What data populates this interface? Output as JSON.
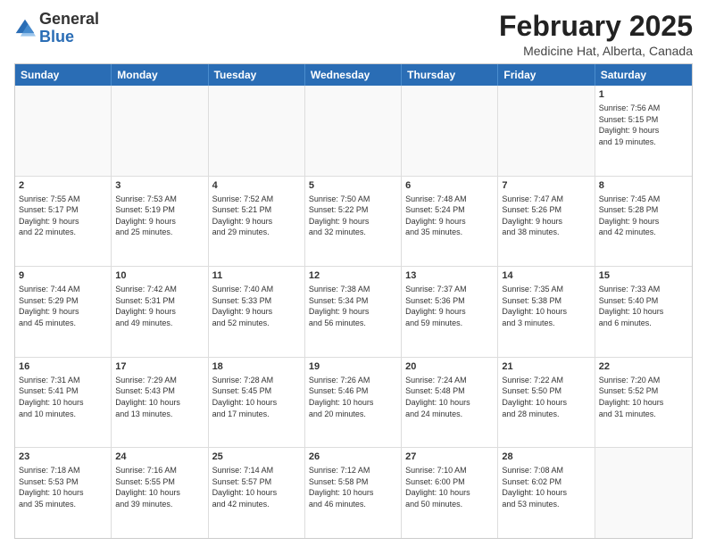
{
  "header": {
    "logo_general": "General",
    "logo_blue": "Blue",
    "title": "February 2025",
    "subtitle": "Medicine Hat, Alberta, Canada"
  },
  "days": [
    "Sunday",
    "Monday",
    "Tuesday",
    "Wednesday",
    "Thursday",
    "Friday",
    "Saturday"
  ],
  "weeks": [
    [
      {
        "day": "",
        "empty": true
      },
      {
        "day": "",
        "empty": true
      },
      {
        "day": "",
        "empty": true
      },
      {
        "day": "",
        "empty": true
      },
      {
        "day": "",
        "empty": true
      },
      {
        "day": "",
        "empty": true
      },
      {
        "day": "1",
        "text": "Sunrise: 7:56 AM\nSunset: 5:15 PM\nDaylight: 9 hours\nand 19 minutes."
      }
    ],
    [
      {
        "day": "2",
        "text": "Sunrise: 7:55 AM\nSunset: 5:17 PM\nDaylight: 9 hours\nand 22 minutes."
      },
      {
        "day": "3",
        "text": "Sunrise: 7:53 AM\nSunset: 5:19 PM\nDaylight: 9 hours\nand 25 minutes."
      },
      {
        "day": "4",
        "text": "Sunrise: 7:52 AM\nSunset: 5:21 PM\nDaylight: 9 hours\nand 29 minutes."
      },
      {
        "day": "5",
        "text": "Sunrise: 7:50 AM\nSunset: 5:22 PM\nDaylight: 9 hours\nand 32 minutes."
      },
      {
        "day": "6",
        "text": "Sunrise: 7:48 AM\nSunset: 5:24 PM\nDaylight: 9 hours\nand 35 minutes."
      },
      {
        "day": "7",
        "text": "Sunrise: 7:47 AM\nSunset: 5:26 PM\nDaylight: 9 hours\nand 38 minutes."
      },
      {
        "day": "8",
        "text": "Sunrise: 7:45 AM\nSunset: 5:28 PM\nDaylight: 9 hours\nand 42 minutes."
      }
    ],
    [
      {
        "day": "9",
        "text": "Sunrise: 7:44 AM\nSunset: 5:29 PM\nDaylight: 9 hours\nand 45 minutes."
      },
      {
        "day": "10",
        "text": "Sunrise: 7:42 AM\nSunset: 5:31 PM\nDaylight: 9 hours\nand 49 minutes."
      },
      {
        "day": "11",
        "text": "Sunrise: 7:40 AM\nSunset: 5:33 PM\nDaylight: 9 hours\nand 52 minutes."
      },
      {
        "day": "12",
        "text": "Sunrise: 7:38 AM\nSunset: 5:34 PM\nDaylight: 9 hours\nand 56 minutes."
      },
      {
        "day": "13",
        "text": "Sunrise: 7:37 AM\nSunset: 5:36 PM\nDaylight: 9 hours\nand 59 minutes."
      },
      {
        "day": "14",
        "text": "Sunrise: 7:35 AM\nSunset: 5:38 PM\nDaylight: 10 hours\nand 3 minutes."
      },
      {
        "day": "15",
        "text": "Sunrise: 7:33 AM\nSunset: 5:40 PM\nDaylight: 10 hours\nand 6 minutes."
      }
    ],
    [
      {
        "day": "16",
        "text": "Sunrise: 7:31 AM\nSunset: 5:41 PM\nDaylight: 10 hours\nand 10 minutes."
      },
      {
        "day": "17",
        "text": "Sunrise: 7:29 AM\nSunset: 5:43 PM\nDaylight: 10 hours\nand 13 minutes."
      },
      {
        "day": "18",
        "text": "Sunrise: 7:28 AM\nSunset: 5:45 PM\nDaylight: 10 hours\nand 17 minutes."
      },
      {
        "day": "19",
        "text": "Sunrise: 7:26 AM\nSunset: 5:46 PM\nDaylight: 10 hours\nand 20 minutes."
      },
      {
        "day": "20",
        "text": "Sunrise: 7:24 AM\nSunset: 5:48 PM\nDaylight: 10 hours\nand 24 minutes."
      },
      {
        "day": "21",
        "text": "Sunrise: 7:22 AM\nSunset: 5:50 PM\nDaylight: 10 hours\nand 28 minutes."
      },
      {
        "day": "22",
        "text": "Sunrise: 7:20 AM\nSunset: 5:52 PM\nDaylight: 10 hours\nand 31 minutes."
      }
    ],
    [
      {
        "day": "23",
        "text": "Sunrise: 7:18 AM\nSunset: 5:53 PM\nDaylight: 10 hours\nand 35 minutes."
      },
      {
        "day": "24",
        "text": "Sunrise: 7:16 AM\nSunset: 5:55 PM\nDaylight: 10 hours\nand 39 minutes."
      },
      {
        "day": "25",
        "text": "Sunrise: 7:14 AM\nSunset: 5:57 PM\nDaylight: 10 hours\nand 42 minutes."
      },
      {
        "day": "26",
        "text": "Sunrise: 7:12 AM\nSunset: 5:58 PM\nDaylight: 10 hours\nand 46 minutes."
      },
      {
        "day": "27",
        "text": "Sunrise: 7:10 AM\nSunset: 6:00 PM\nDaylight: 10 hours\nand 50 minutes."
      },
      {
        "day": "28",
        "text": "Sunrise: 7:08 AM\nSunset: 6:02 PM\nDaylight: 10 hours\nand 53 minutes."
      },
      {
        "day": "",
        "empty": true
      }
    ]
  ]
}
